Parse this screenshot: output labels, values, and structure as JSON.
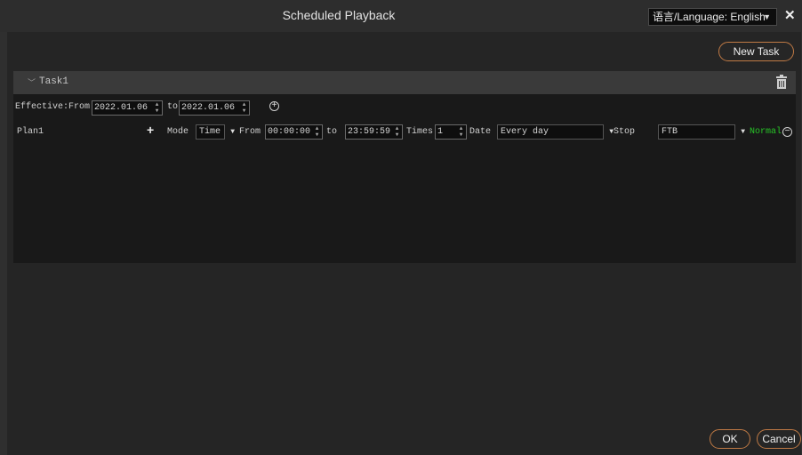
{
  "window": {
    "title": "Scheduled Playback",
    "language_select": "语言/Language: English",
    "close_glyph": "✕"
  },
  "toolbar": {
    "new_task_label": "New Task"
  },
  "task": {
    "name": "Task1",
    "effective_label": "Effective:From",
    "effective_from": "2022.01.06",
    "to_label": "to",
    "effective_to": "2022.01.06",
    "plan": {
      "name": "Plan1",
      "mode_label": "Mode",
      "mode_value": "Time",
      "from_label": "From",
      "from_time": "00:00:00",
      "to_label": "to",
      "to_time": "23:59:59",
      "times_label": "Times",
      "times_value": "1",
      "date_label": "Date",
      "date_value": "Every day",
      "stop_label": "Stop",
      "stop_value": "FTB",
      "status": "Normal"
    }
  },
  "footer": {
    "ok_label": "OK",
    "cancel_label": "Cancel"
  },
  "colors": {
    "accent_border": "#c07a45",
    "status_green": "#27c427"
  },
  "icons": [
    "close-icon",
    "chevron-down-icon",
    "trash-icon",
    "add-circle-icon",
    "plus-icon",
    "minus-circle-icon"
  ]
}
